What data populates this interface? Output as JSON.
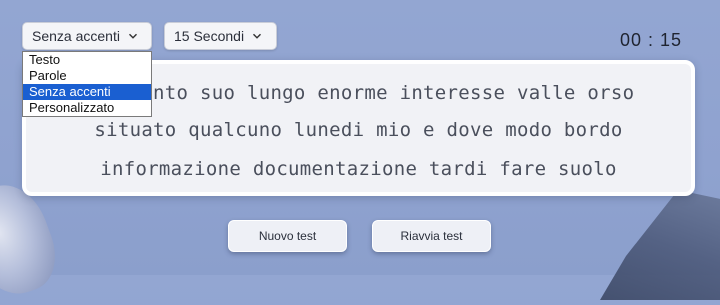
{
  "controls": {
    "mode_select_value": "Senza accenti",
    "time_select_value": "15 Secondi",
    "mode_options": [
      "Testo",
      "Parole",
      "Senza accenti",
      "Personalizzato"
    ],
    "selected_option_index": 2
  },
  "timer": {
    "value": "00 : 15"
  },
  "words": {
    "line1": "prendento suo lungo enorme interesse valle orso",
    "line2": "situato qualcuno lunedi mio e dove modo bordo",
    "line3": "informazione documentazione tardi fare suolo"
  },
  "buttons": {
    "new_test": "Nuovo test",
    "restart_test": "Riavvia test"
  },
  "colors": {
    "background": "#93a6d2",
    "selected_option": "#1a5fd1",
    "panel": "#f1f2f6"
  }
}
